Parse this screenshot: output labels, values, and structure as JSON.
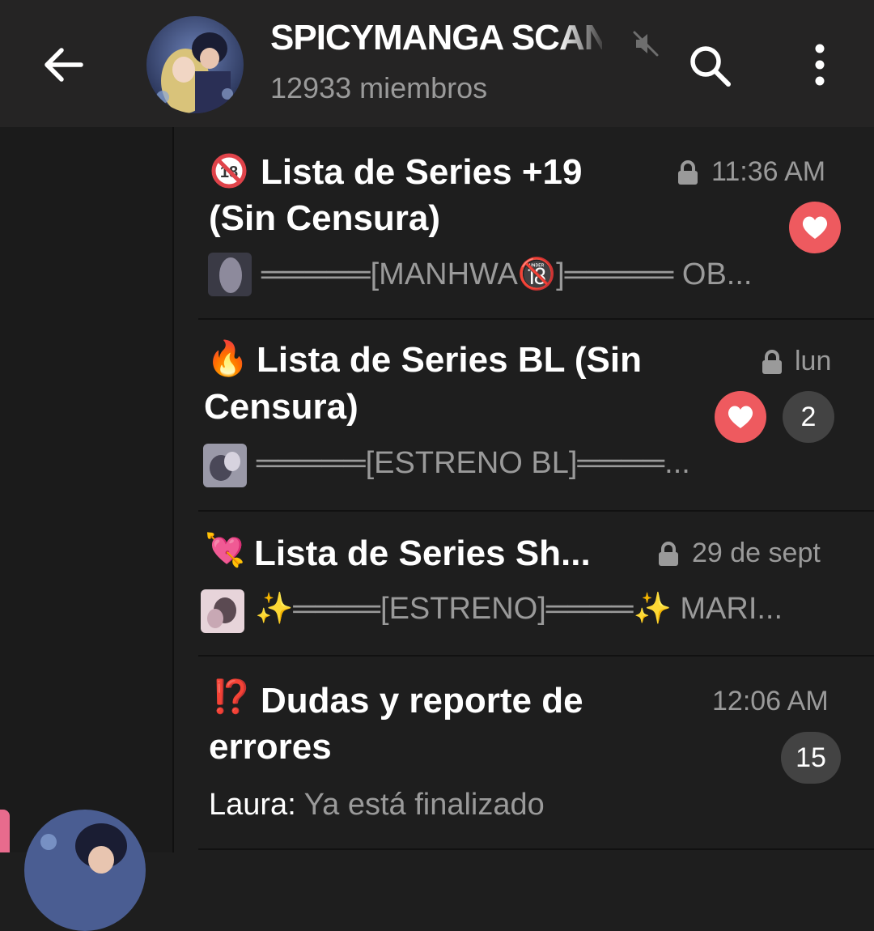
{
  "header": {
    "title": "SPICYMANGA SCANS",
    "subtitle": "12933 miembros"
  },
  "topics": [
    {
      "emoji": "🔞",
      "title_line1": "Lista de Series +19",
      "title_line2": "(Sin Censura)",
      "time": "11:36 AM",
      "locked": true,
      "preview": "═════[MANHWA🔞]═════ OB...",
      "reaction": "heart",
      "unread": ""
    },
    {
      "emoji": "🔥",
      "title_line1": "Lista de Series BL (Sin",
      "title_line2": "Censura)",
      "time": "lun",
      "locked": true,
      "preview": "═════[ESTRENO BL]════...",
      "reaction": "heart",
      "unread": "2"
    },
    {
      "emoji": "💘",
      "title_line1": "Lista de Series Sh...",
      "time": "29 de sept",
      "locked": true,
      "preview": "✨════[ESTRENO]════✨  MARI..."
    },
    {
      "emoji": "⁉️",
      "title_line1": "Dudas y reporte de",
      "title_line2": "errores",
      "time": "12:06 AM",
      "locked": false,
      "preview_sender": "Laura:",
      "preview": "Ya está finalizado",
      "unread": "15"
    }
  ],
  "colors": {
    "header_bg": "#252424",
    "list_bg": "#1e1e1e",
    "heart_badge": "#ee5a5f",
    "count_badge": "#434343",
    "muted_text": "#9a9a9a",
    "selection_accent": "#e86b8d"
  },
  "icons": [
    "back-arrow-icon",
    "muted-speaker-icon",
    "search-icon",
    "more-vertical-icon",
    "lock-icon",
    "heart-icon"
  ]
}
